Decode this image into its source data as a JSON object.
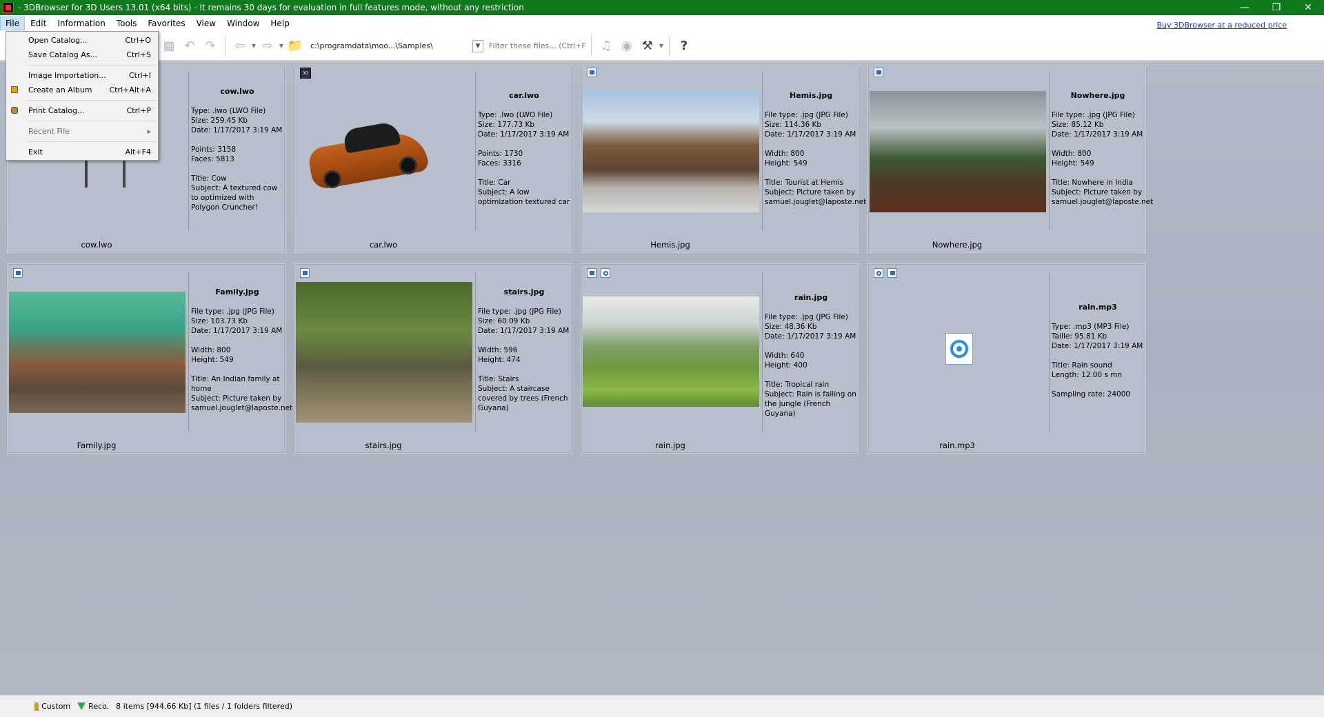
{
  "window": {
    "title": "- 3DBrowser for 3D Users 13.01 (x64 bits) - It remains 30 days for evaluation in full features mode, without any restriction",
    "controls": [
      "—",
      "❐",
      "✕"
    ]
  },
  "menubar": {
    "items": [
      "File",
      "Edit",
      "Information",
      "Tools",
      "Favorites",
      "View",
      "Window",
      "Help"
    ],
    "buy_link": "Buy 3DBrowser at a reduced price"
  },
  "file_menu": {
    "items": [
      {
        "label": "Open Catalog...",
        "shortcut": "Ctrl+O"
      },
      {
        "label": "Save Catalog As...",
        "shortcut": "Ctrl+S"
      },
      {
        "label": "Image Importation...",
        "shortcut": "Ctrl+I"
      },
      {
        "label": "Create an Album",
        "shortcut": "Ctrl+Alt+A"
      },
      {
        "label": "Print Catalog...",
        "shortcut": "Ctrl+P"
      },
      {
        "label": "Recent File",
        "shortcut": "▸"
      },
      {
        "label": "Exit",
        "shortcut": "Alt+F4"
      }
    ]
  },
  "toolbar": {
    "path": "c:\\programdata\\moo...\\Samples\\",
    "filter_placeholder": "Filter these files... (Ctrl+F)",
    "help": "?"
  },
  "cards": [
    {
      "fname": "cow.lwo",
      "caption": "cow.lwo",
      "lines1": [
        "Type: .lwo (LWO File)",
        "Size: 259.45 Kb",
        "Date: 1/17/2017 3:19 AM"
      ],
      "lines2": [
        "Points: 3158",
        "Faces: 5813"
      ],
      "lines3": [
        "Title: Cow",
        "Subject: A textured cow to optimized with Polygon Cruncher!"
      ]
    },
    {
      "fname": "car.lwo",
      "caption": "car.lwo",
      "lines1": [
        "Type: .lwo (LWO File)",
        "Size: 177.73 Kb",
        "Date: 1/17/2017 3:19 AM"
      ],
      "lines2": [
        "Points: 1730",
        "Faces: 3316"
      ],
      "lines3": [
        "Title: Car",
        "Subject: A low optimization textured car"
      ]
    },
    {
      "fname": "Hemis.jpg",
      "caption": "Hemis.jpg",
      "lines1": [
        "File type: .jpg (JPG File)",
        "Size: 114.36 Kb",
        "Date: 1/17/2017 3:19 AM"
      ],
      "lines2": [
        "Width: 800",
        "Height: 549"
      ],
      "lines3": [
        "Title: Tourist at Hemis",
        "Subject: Picture taken by samuel.jouglet@laposte.net"
      ]
    },
    {
      "fname": "Nowhere.jpg",
      "caption": "Nowhere.jpg",
      "lines1": [
        "File type: .jpg (JPG File)",
        "Size: 85.12 Kb",
        "Date: 1/17/2017 3:19 AM"
      ],
      "lines2": [
        "Width: 800",
        "Height: 549"
      ],
      "lines3": [
        "Title: Nowhere in India",
        "Subject: Picture taken by samuel.jouglet@laposte.net"
      ]
    },
    {
      "fname": "Family.jpg",
      "caption": "Family.jpg",
      "lines1": [
        "File type: .jpg (JPG File)",
        "Size: 103.73 Kb",
        "Date: 1/17/2017 3:19 AM"
      ],
      "lines2": [
        "Width: 800",
        "Height: 549"
      ],
      "lines3": [
        "Title: An Indian family at home",
        "Subject: Picture taken by samuel.jouglet@laposte.net"
      ]
    },
    {
      "fname": "stairs.jpg",
      "caption": "stairs.jpg",
      "lines1": [
        "File type: .jpg (JPG File)",
        "Size: 60.09 Kb",
        "Date: 1/17/2017 3:19 AM"
      ],
      "lines2": [
        "Width: 596",
        "Height: 474"
      ],
      "lines3": [
        "Title: Stairs",
        "Subject: A staircase covered by trees (French Guyana)"
      ]
    },
    {
      "fname": "rain.jpg",
      "caption": "rain.jpg",
      "lines1": [
        "File type: .jpg (JPG File)",
        "Size: 48.36 Kb",
        "Date: 1/17/2017 3:19 AM"
      ],
      "lines2": [
        "Width: 640",
        "Height: 400"
      ],
      "lines3": [
        "Title: Tropical rain",
        "Subject: Rain is falling on the jungle (French Guyana)"
      ]
    },
    {
      "fname": "rain.mp3",
      "caption": "rain.mp3",
      "lines1": [
        "Type: .mp3 (MP3 File)",
        "Taille: 95.81 Kb",
        "Date: 1/17/2017 3:19 AM"
      ],
      "lines2": [
        "Title: Rain sound",
        "Length: 12.00 s mn"
      ],
      "lines3": [
        "Sampling rate: 24000"
      ]
    }
  ],
  "statusbar": {
    "custom": "Custom",
    "reco": "Reco.",
    "summary": "8 items [944.66 Kb] (1 files / 1 folders filtered)"
  }
}
